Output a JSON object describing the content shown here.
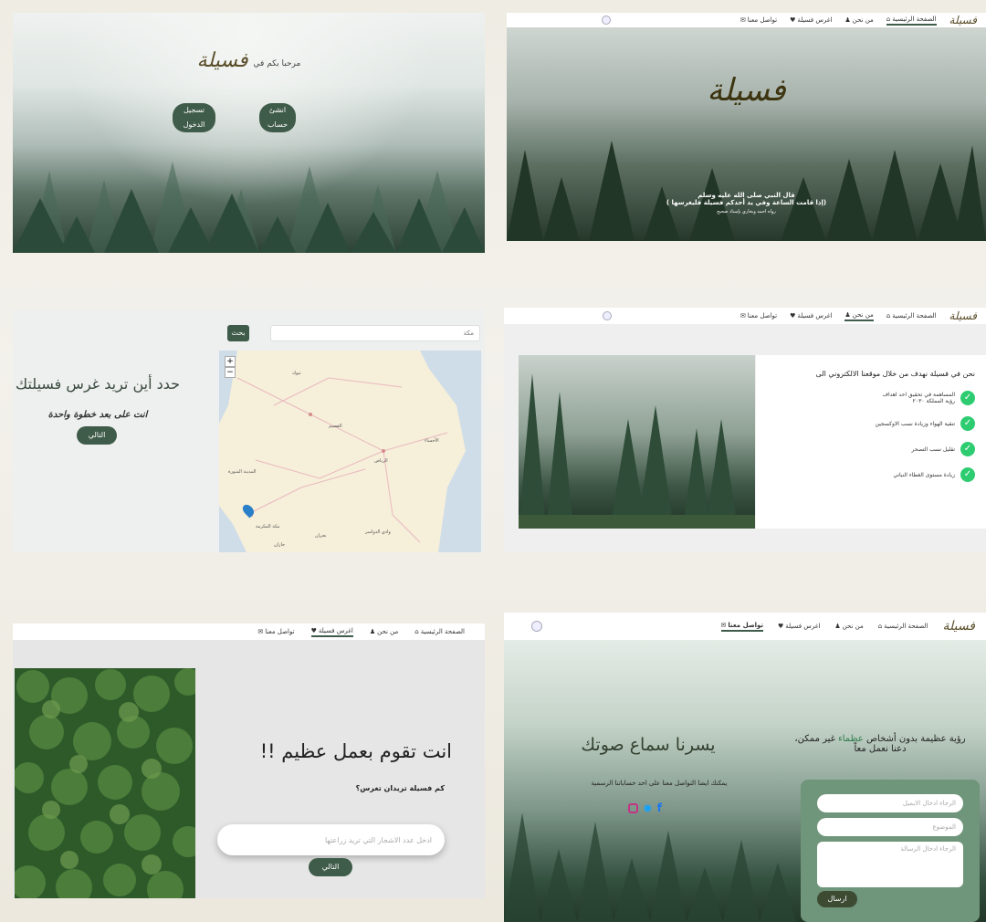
{
  "panel_welcome": {
    "welcome_text": "مرحبا بكم في",
    "logo_text": "فسيلة",
    "create_account": "انشئ حساب",
    "login": "تسجيل الدخول"
  },
  "panel_hero": {
    "nav": {
      "logo": "فسيلة",
      "home": "الصفحة الرئيسية",
      "about": "من نحن",
      "plant": "اغرس فسيلة",
      "contact": "تواصل معنا"
    },
    "title": "فسيلة",
    "quote_line1": "قال النبي صلى الله عليه وسلم",
    "quote_line2": "(إذا قامت الساعة وفي يد أحدكم فسيلة فليغرسها )",
    "quote_source": "رواه احمد وبخاري بإسناد صحيح"
  },
  "panel_map": {
    "search_placeholder": "مكة",
    "search_button": "بحث",
    "zoom_in": "+",
    "zoom_out": "−",
    "heading": "حدد أين تريد غرس فسيلتك",
    "subheading": "انت على بعد خطوة واحدة",
    "next": "التالي",
    "map_labels": [
      "مكة المكرمة",
      "المدينة المنورة",
      "الرياض",
      "الأحساء",
      "تبوك",
      "وادي الدواسر",
      "القصيم",
      "جازان",
      "نجران"
    ]
  },
  "panel_about": {
    "nav": {
      "logo": "فسيلة",
      "home": "الصفحة الرئيسية",
      "about": "من نحن",
      "plant": "اغرس فسيلة",
      "contact": "تواصل معنا"
    },
    "intro": "نحن في فسيلة نهدف من خلال موقعنا الالكتروني الى",
    "goals": [
      "المساهمة في تحقيق احد اهداف رؤية المملكة ٢٠٣٠",
      "تنقية الهواء وزيادة نسب الاوكسجين",
      "تقليل نسب التصحر",
      "زيادة مستوى الغطاء النباتي"
    ]
  },
  "panel_plant": {
    "nav": {
      "home": "الصفحة الرئيسية",
      "about": "من نحن",
      "plant": "اغرس فسيلة",
      "contact": "تواصل معنا"
    },
    "heading": "انت تقوم بعمل عظيم !!",
    "question": "كم فسيلة تريدان تغرس؟",
    "input_placeholder": "ادخل عدد الاشجار التي تريد زراعتها",
    "next": "التالي"
  },
  "panel_contact": {
    "nav": {
      "logo": "فسيلة",
      "home": "الصفحة الرئيسية",
      "about": "من نحن",
      "plant": "اغرس فسيلة",
      "contact": "تواصل معنا"
    },
    "vision_line1_pre": "رؤية عظيمة بدون أشخاص",
    "vision_highlight": "عظماء",
    "vision_line1_post": "غير ممكن،",
    "vision_line2": "دعنا نعمل معاً",
    "happy": "يسرنا سماع صوتك",
    "social_text": "يمكنك ايضا التواصل معنا على احد حساباتنا الرسمية",
    "email_placeholder": "الرجاء ادخال الايميل",
    "subject_placeholder": "الموضوع",
    "message_placeholder": "الرجاء ادخال الرسالة",
    "send": "ارسال",
    "social_icons": [
      "instagram-icon",
      "twitter-icon",
      "facebook-icon"
    ]
  },
  "colors": {
    "brand_dark_green": "#3f5b49",
    "contact_card_green": "#6f957a",
    "check_green": "#2ecc71",
    "logo_brown": "#5a4e2a"
  }
}
